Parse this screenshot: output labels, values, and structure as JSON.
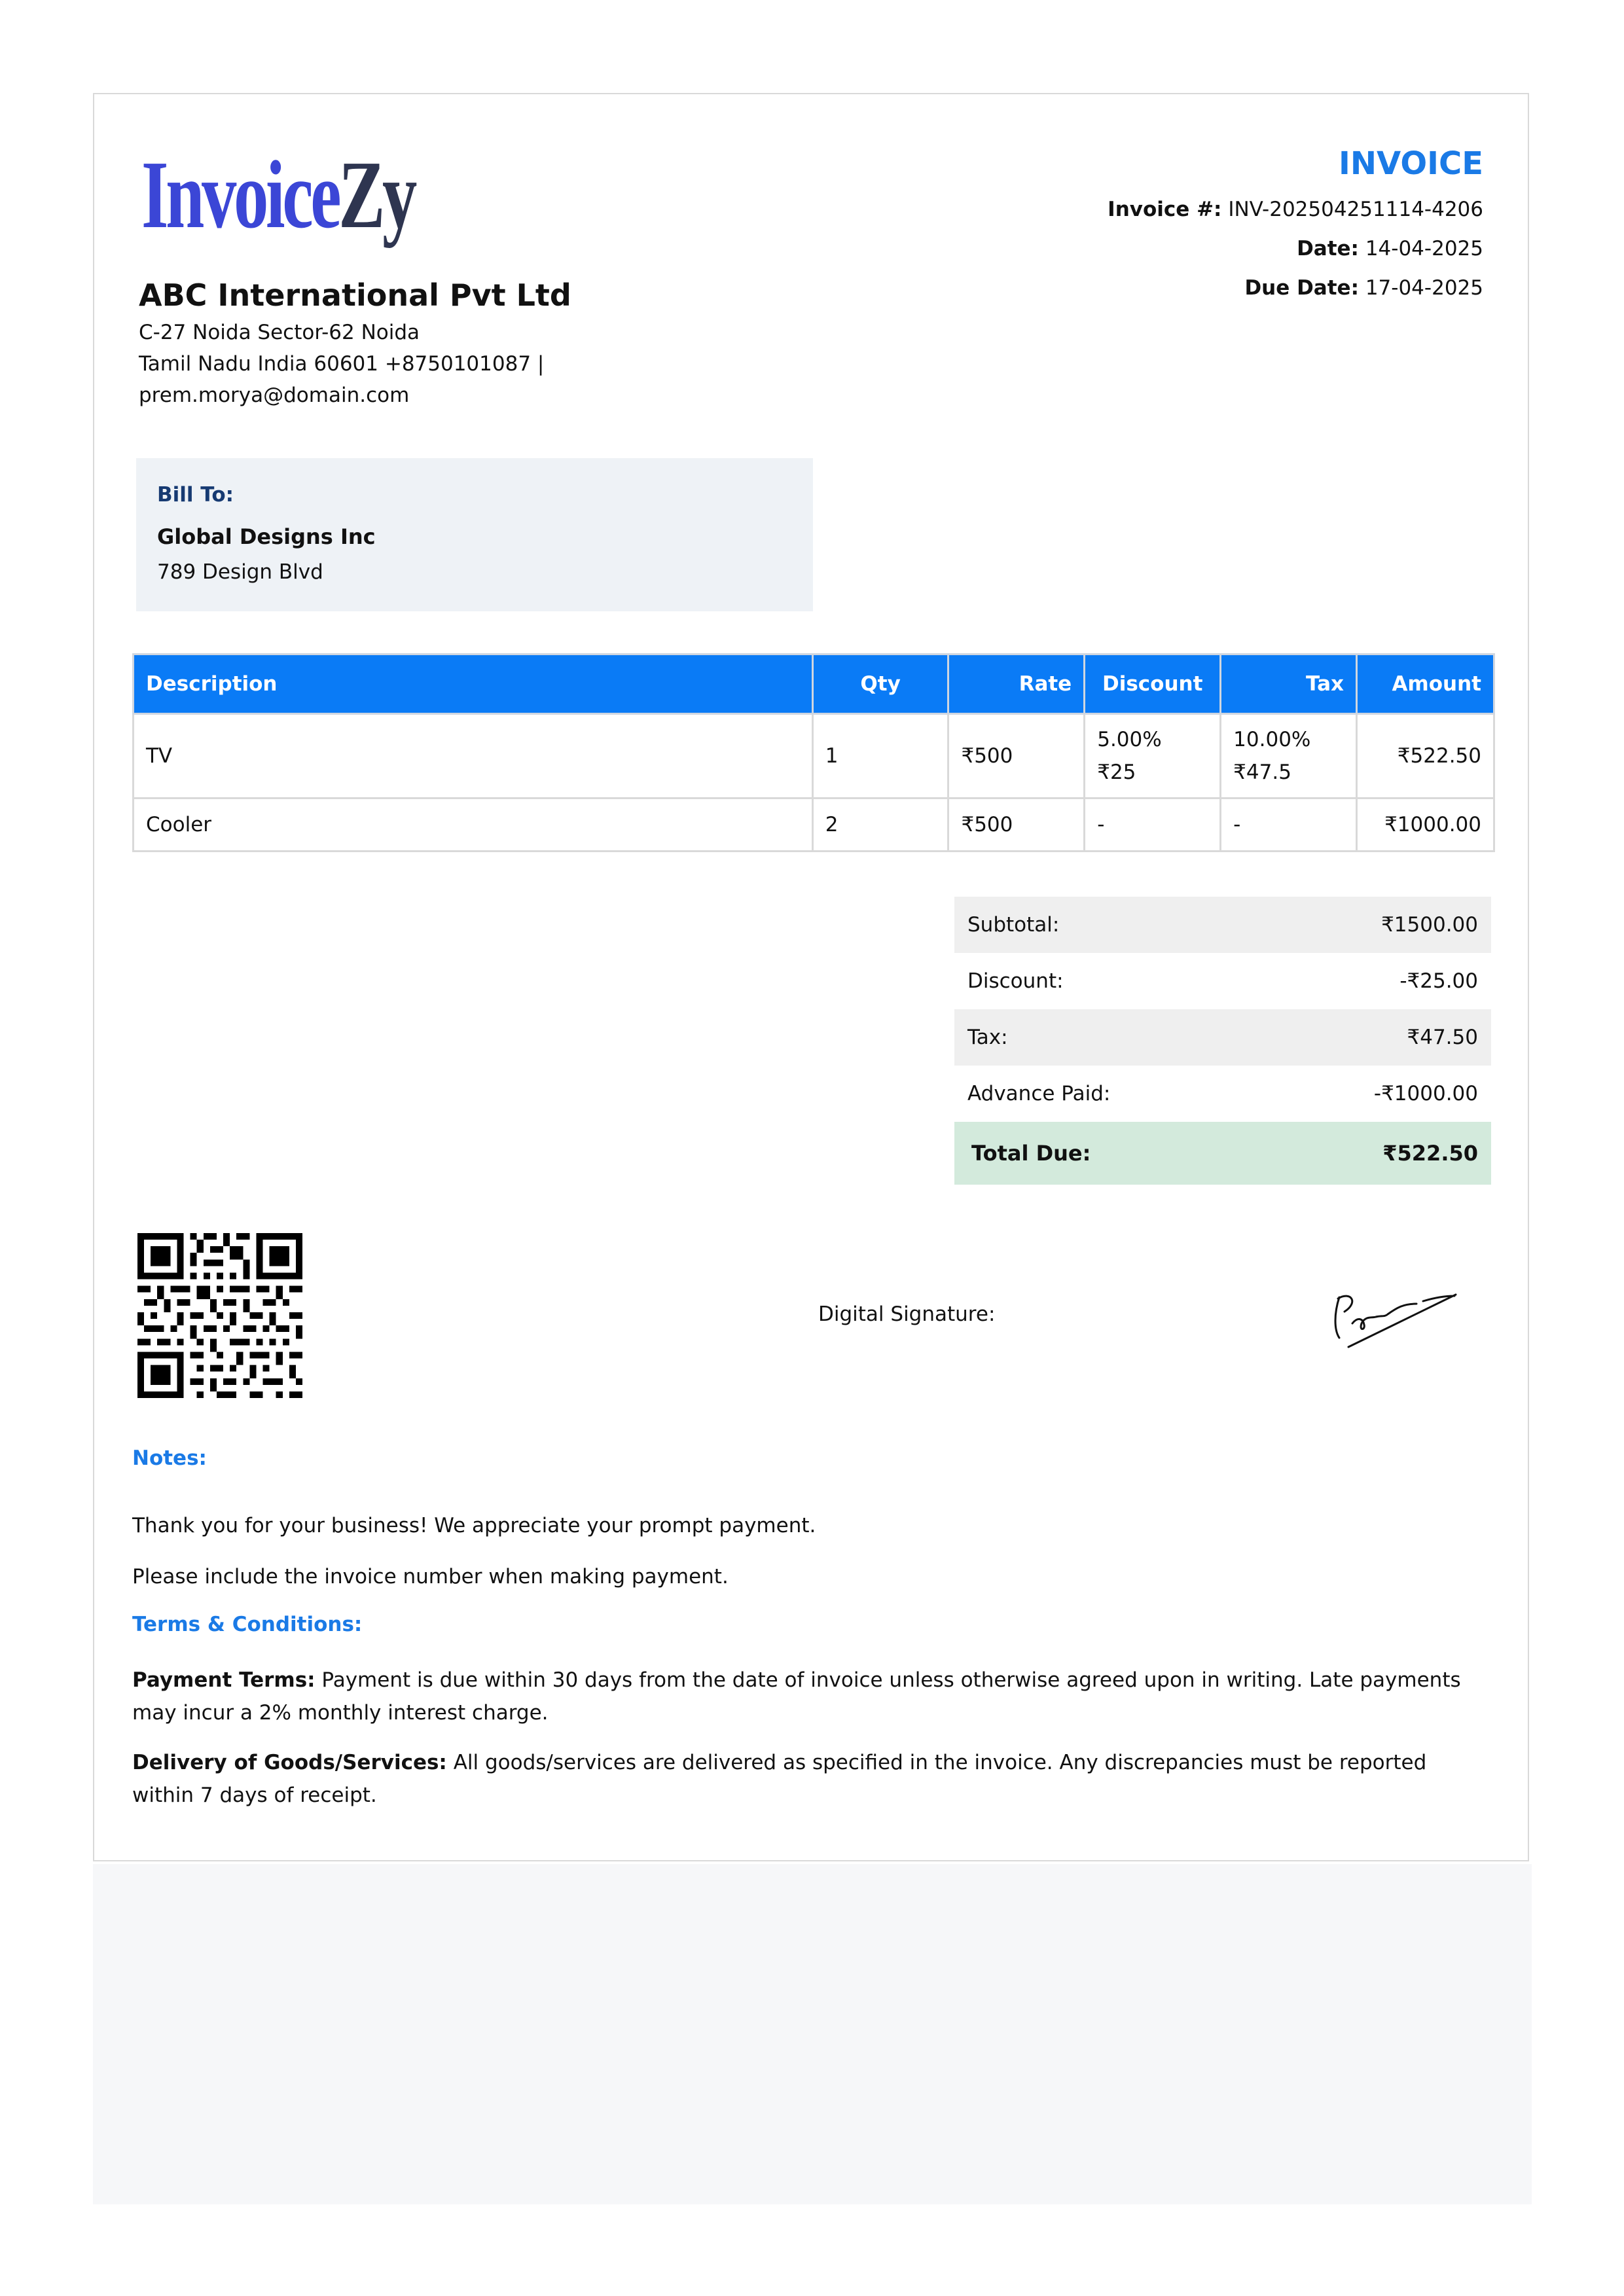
{
  "logo": {
    "part1": "Invoice",
    "part2": "Zy"
  },
  "company": {
    "name": "ABC International Pvt Ltd",
    "address_line1": "C-27 Noida Sector-62 Noida",
    "address_line2": "Tamil Nadu India 60601 +8750101087 |",
    "email": "prem.morya@domain.com"
  },
  "invoice": {
    "title": "INVOICE",
    "number_label": "Invoice #:",
    "number": "INV-202504251114-4206",
    "date_label": "Date:",
    "date": "14-04-2025",
    "due_label": "Due Date:",
    "due": "17-04-2025"
  },
  "bill_to": {
    "label": "Bill To:",
    "name": "Global Designs Inc",
    "address": "789 Design Blvd"
  },
  "table": {
    "headers": [
      "Description",
      "Qty",
      "Rate",
      "Discount",
      "Tax",
      "Amount"
    ],
    "rows": [
      {
        "description": "TV",
        "qty": "1",
        "rate": "₹500",
        "discount_pct": "5.00%",
        "discount_amt": "₹25",
        "tax_pct": "10.00%",
        "tax_amt": "₹47.5",
        "amount": "₹522.50"
      },
      {
        "description": "Cooler",
        "qty": "2",
        "rate": "₹500",
        "discount": "-",
        "tax": "-",
        "amount": "₹1000.00"
      }
    ]
  },
  "totals": {
    "subtotal_label": "Subtotal:",
    "subtotal": "₹1500.00",
    "discount_label": "Discount:",
    "discount": "-₹25.00",
    "tax_label": "Tax:",
    "tax": "₹47.50",
    "advance_label": "Advance Paid:",
    "advance": "-₹1000.00",
    "total_label": "Total Due:",
    "total": "₹522.50"
  },
  "signature": {
    "label": "Digital Signature:"
  },
  "notes": {
    "heading": "Notes:",
    "line1": "Thank you for your business! We appreciate your prompt payment.",
    "line2": "Please include the invoice number when making payment."
  },
  "terms": {
    "heading": "Terms & Conditions:",
    "payment_label": "Payment Terms:",
    "payment_text": " Payment is due within 30 days from the date of invoice unless otherwise agreed upon in writing. Late payments may incur a 2% monthly interest charge.",
    "delivery_label": "Delivery of Goods/Services:",
    "delivery_text": " All goods/services are delivered as specified in the invoice. Any discrepancies must be reported within 7 days of receipt."
  },
  "colors": {
    "accent": "#1a7ae6",
    "header_bg": "#0a7bf6",
    "billto_bg": "#eef2f6",
    "total_bg": "#d3eadc"
  }
}
